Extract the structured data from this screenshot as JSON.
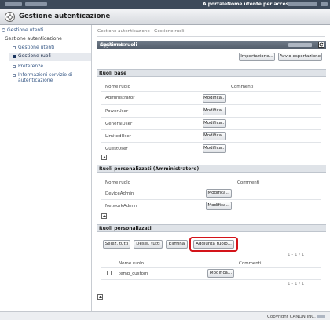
{
  "topbar": {
    "portal_label": "A portale",
    "user_label": "Nome utente per accesso:"
  },
  "header": {
    "title": "Gestione autenticazione",
    "icon": "gear-icon"
  },
  "sidebar": {
    "top_link": "Gestione utenti",
    "section": "Gestione autenticazione",
    "items": [
      {
        "label": "Gestione utenti",
        "active": false
      },
      {
        "label": "Gestione ruoli",
        "active": true
      },
      {
        "label": "Preferenze",
        "active": false
      },
      {
        "label": "Informazioni servizio di",
        "label2": "autenticazione",
        "active": false
      }
    ]
  },
  "breadcrumb": "Gestione autenticazione : Gestione ruoli",
  "roles_panel": {
    "title": "Gestione ruoli",
    "updated_label": "Aggiornato:",
    "import_button": "Importazione...",
    "export_button": "Avvio esportazione"
  },
  "base_roles": {
    "title": "Ruoli base",
    "col_name": "Nome ruolo",
    "col_comments": "Commenti",
    "rows": [
      {
        "name": "Administrator",
        "action": "Modifica..."
      },
      {
        "name": "PowerUser",
        "action": "Modifica..."
      },
      {
        "name": "GeneralUser",
        "action": "Modifica..."
      },
      {
        "name": "LimitedUser",
        "action": "Modifica..."
      },
      {
        "name": "GuestUser",
        "action": "Modifica..."
      }
    ]
  },
  "admin_custom_roles": {
    "title": "Ruoli personalizzati (Amministratore)",
    "col_name": "Nome ruolo",
    "col_comments": "Commenti",
    "rows": [
      {
        "name": "DeviceAdmin",
        "action": "Modifica..."
      },
      {
        "name": "NetworkAdmin",
        "action": "Modifica..."
      }
    ]
  },
  "custom_roles": {
    "title": "Ruoli personalizzati",
    "select_all": "Selez. tutti",
    "deselect_all": "Desel. tutti",
    "delete": "Elimina",
    "add_role": "Aggiunta ruolo...",
    "pager_top": "1 - 1 / 1",
    "pager_bottom": "1 - 1 / 1",
    "col_name": "Nome ruolo",
    "col_comments": "Commenti",
    "rows": [
      {
        "name": "temp_custom",
        "action": "Modifica..."
      }
    ]
  },
  "footer": {
    "copyright": "Copyright CANON INC."
  },
  "colors": {
    "topbar": "#3d4a5a",
    "panel_title": "#5f6a78",
    "highlight": "#d4141a"
  }
}
